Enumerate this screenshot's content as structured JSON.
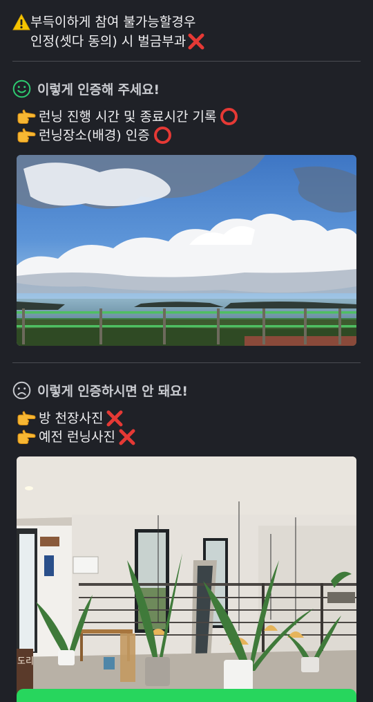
{
  "warning": {
    "icon": "warning-icon",
    "line1": "부득이하게 참여 불가능할경우",
    "line2": "인정(셋다 동의) 시 벌금부과",
    "line2_icon": "cross-icon"
  },
  "good_section": {
    "icon": "smile-face-icon",
    "title": "이렇게 인증해 주세요!",
    "rules": [
      {
        "icon": "pointing-hand-icon",
        "text": "런닝 진행 시간 및 종료시간 기록",
        "mark": "circle-icon"
      },
      {
        "icon": "pointing-hand-icon",
        "text": "런닝장소(배경) 인증",
        "mark": "circle-icon"
      }
    ],
    "photo": "seaside-sky-photo"
  },
  "bad_section": {
    "icon": "frown-face-icon",
    "title": "이렇게 인증하시면 안 돼요!",
    "rules": [
      {
        "icon": "pointing-hand-icon",
        "text": "방 천장사진",
        "mark": "cross-icon"
      },
      {
        "icon": "pointing-hand-icon",
        "text": "예전 런닝사진",
        "mark": "cross-icon"
      }
    ],
    "photo": "indoor-room-photo",
    "photo_sign_text": "도리"
  },
  "colors": {
    "background": "#1f2127",
    "accent_green": "#27d65d",
    "cross_red": "#e53935",
    "warning_yellow": "#f5c400"
  }
}
